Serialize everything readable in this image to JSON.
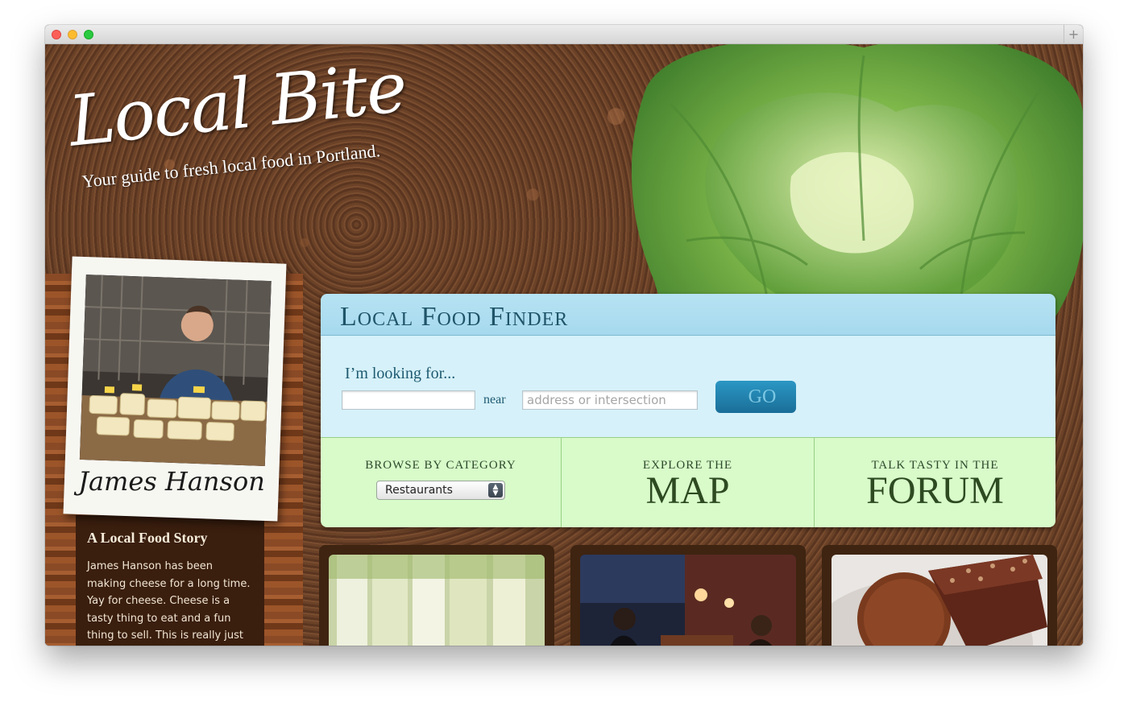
{
  "site": {
    "logo_text": "Local Bite",
    "tagline": "Your guide to fresh local food in Portland."
  },
  "profile": {
    "name": "James Hanson",
    "story_title": "A Local Food Story",
    "story_body": "James Hanson has been making cheese for a long time. Yay for cheese. Cheese is a tasty thing to eat and a fun thing to sell. This is really just filler text that will look slightly"
  },
  "finder": {
    "title": "Local Food Finder",
    "looking_label": "I’m looking for...",
    "what_value": "",
    "near_label": "near",
    "where_placeholder": "address or intersection",
    "go_label": "GO"
  },
  "browse": {
    "category_kicker": "BROWSE BY CATEGORY",
    "category_selected": "Restaurants",
    "map_kicker": "EXPLORE THE",
    "map_label": "MAP",
    "forum_kicker": "TALK TASTY IN THE",
    "forum_label": "FORUM"
  },
  "icons": {
    "close": "traffic-close",
    "minimize": "traffic-minimize",
    "maximize": "traffic-maximize",
    "new_tab": "+"
  },
  "colors": {
    "finder_header": "#a6d9ee",
    "finder_search": "#d6f1fa",
    "browse_bg": "#d8fbc9",
    "go_button": "#1a6e98",
    "title_text": "#1f5468",
    "browse_text": "#2d4a21"
  }
}
